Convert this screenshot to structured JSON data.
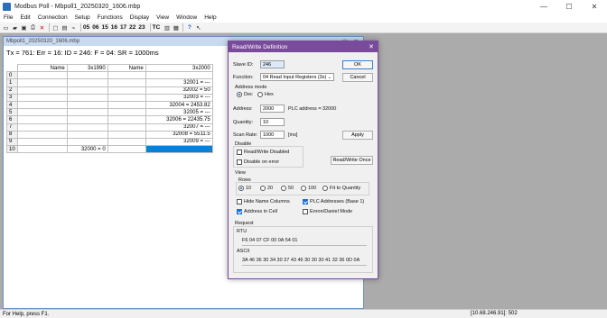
{
  "window": {
    "title": "Modbus Poll - Mbpoll1_20250320_1606.mbp",
    "min": "—",
    "max": "☐",
    "close": "✕"
  },
  "menu": [
    "File",
    "Edit",
    "Connection",
    "Setup",
    "Functions",
    "Display",
    "View",
    "Window",
    "Help"
  ],
  "toolbar": {
    "codes": [
      "05",
      "06",
      "15",
      "16",
      "17",
      "22",
      "23"
    ],
    "tc": "TC",
    "help_mark": "?"
  },
  "child": {
    "title": "Mbpoll1_20250320_1606.mbp",
    "status": "Tx = 761: Err = 16: ID = 246: F = 04: SR = 1000ms",
    "columns": [
      "Name",
      "3x1990",
      "Name",
      "3x2000"
    ],
    "rows": [
      {
        "i": "0",
        "c1": "",
        "c2": "",
        "c3": "",
        "c4": ""
      },
      {
        "i": "1",
        "c1": "",
        "c2": "",
        "c3": "",
        "c4": "32001 = ---"
      },
      {
        "i": "2",
        "c1": "",
        "c2": "",
        "c3": "",
        "c4": "32002 = 50"
      },
      {
        "i": "3",
        "c1": "",
        "c2": "",
        "c3": "",
        "c4": "32003 = ---"
      },
      {
        "i": "4",
        "c1": "",
        "c2": "",
        "c3": "",
        "c4": "32004 = 2453.82"
      },
      {
        "i": "5",
        "c1": "",
        "c2": "",
        "c3": "",
        "c4": "32005 = ---"
      },
      {
        "i": "6",
        "c1": "",
        "c2": "",
        "c3": "",
        "c4": "32006 = 22435.75"
      },
      {
        "i": "7",
        "c1": "",
        "c2": "",
        "c3": "",
        "c4": "32007 = ---"
      },
      {
        "i": "8",
        "c1": "",
        "c2": "",
        "c3": "",
        "c4": "32008 = 5511.5"
      },
      {
        "i": "9",
        "c1": "",
        "c2": "",
        "c3": "",
        "c4": "32009 = ---"
      },
      {
        "i": "10",
        "c1": "",
        "c2": "32000 = 0",
        "c3": "",
        "c4": ""
      }
    ]
  },
  "dialog": {
    "title": "Read/Write Definition",
    "close": "✕",
    "slave_id_label": "Slave ID:",
    "slave_id": "246",
    "function_label": "Function:",
    "function_value": "04 Read Input Registers (3x)",
    "address_mode_label": "Address mode",
    "dec_label": "Dec",
    "hex_label": "Hex",
    "address_label": "Address:",
    "address_value": "2000",
    "plc_address": "PLC address = 32000",
    "quantity_label": "Quantity:",
    "quantity_value": "10",
    "scan_rate_label": "Scan Rate:",
    "scan_rate_value": "1000",
    "scan_rate_unit": "[ms]",
    "disable_label": "Disable",
    "rw_disabled": "Read/Write Disabled",
    "disable_on_error": "Disable on error",
    "view_label": "View",
    "rows_label": "Rows",
    "rows_options": [
      "10",
      "20",
      "50",
      "100",
      "Fit to Quantity"
    ],
    "hide_name_columns": "Hide Name Columns",
    "plc_addresses_base": "PLC Addresses (Base 1)",
    "address_in_cell": "Address in Cell",
    "enron_daniel": "Enron/Daniel Mode",
    "request_label": "Request",
    "rtu_label": "RTU",
    "rtu_value": "F6 04 07 CF 00 0A 54 01",
    "ascii_label": "ASCII",
    "ascii_value": "3A 46 36 30 34 30 37 43 46 30 30 30 41 32 36 0D 0A",
    "ok": "OK",
    "cancel": "Cancel",
    "apply": "Apply",
    "rw_once": "Read/Write Once"
  },
  "statusbar": {
    "help": "For Help, press F1.",
    "connection": "[10.68.246.91]: 502"
  }
}
